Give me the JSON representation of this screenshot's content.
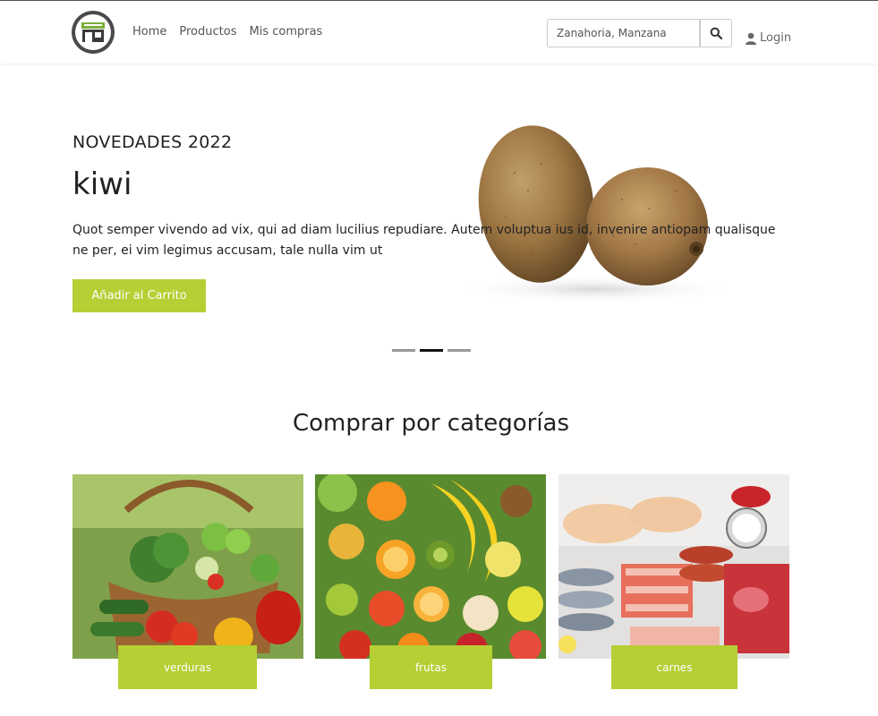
{
  "brand": {
    "logo_icon": "store-icon",
    "accent_color": "#b5cf34"
  },
  "nav": {
    "items": [
      {
        "label": "Home"
      },
      {
        "label": "Productos"
      },
      {
        "label": "Mis compras"
      }
    ]
  },
  "search": {
    "placeholder": "Zanahoria, Manzana",
    "icon": "search-icon"
  },
  "login": {
    "label": "Login",
    "icon": "user-icon"
  },
  "hero": {
    "eyebrow": "NOVEDADES 2022",
    "title": "kiwi",
    "description": "Quot semper vivendo ad vix, qui ad diam lucilius repudiare. Autem voluptua ius id, invenire antiopam qualisque ne per, ei vim legimus accusam, tale nulla vim ut",
    "cta_label": "Añadir al Carrito",
    "slides_total": 3,
    "active_slide": 2
  },
  "categories": {
    "title": "Comprar por categorías",
    "items": [
      {
        "label": "verduras"
      },
      {
        "label": "frutas"
      },
      {
        "label": "carnes"
      }
    ]
  }
}
